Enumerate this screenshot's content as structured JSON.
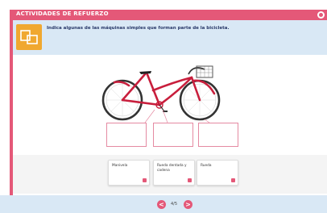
{
  "header": {
    "title": "ACTIVIDADES DE REFUERZO"
  },
  "instruction": {
    "text": "Indica algunas de las máquinas simples que forman parte de la bicicleta."
  },
  "answer_cards": [
    {
      "label": "Manivela"
    },
    {
      "label": "Rueda dentada y cadena"
    },
    {
      "label": "Rueda"
    }
  ],
  "pagination": {
    "prev": "<",
    "next": ">",
    "page": "4/5"
  },
  "colors": {
    "accent": "#e45878",
    "instruction_bg": "#d9e8f5",
    "icon_orange": "#f0a830",
    "bike_red": "#c81e3c"
  }
}
